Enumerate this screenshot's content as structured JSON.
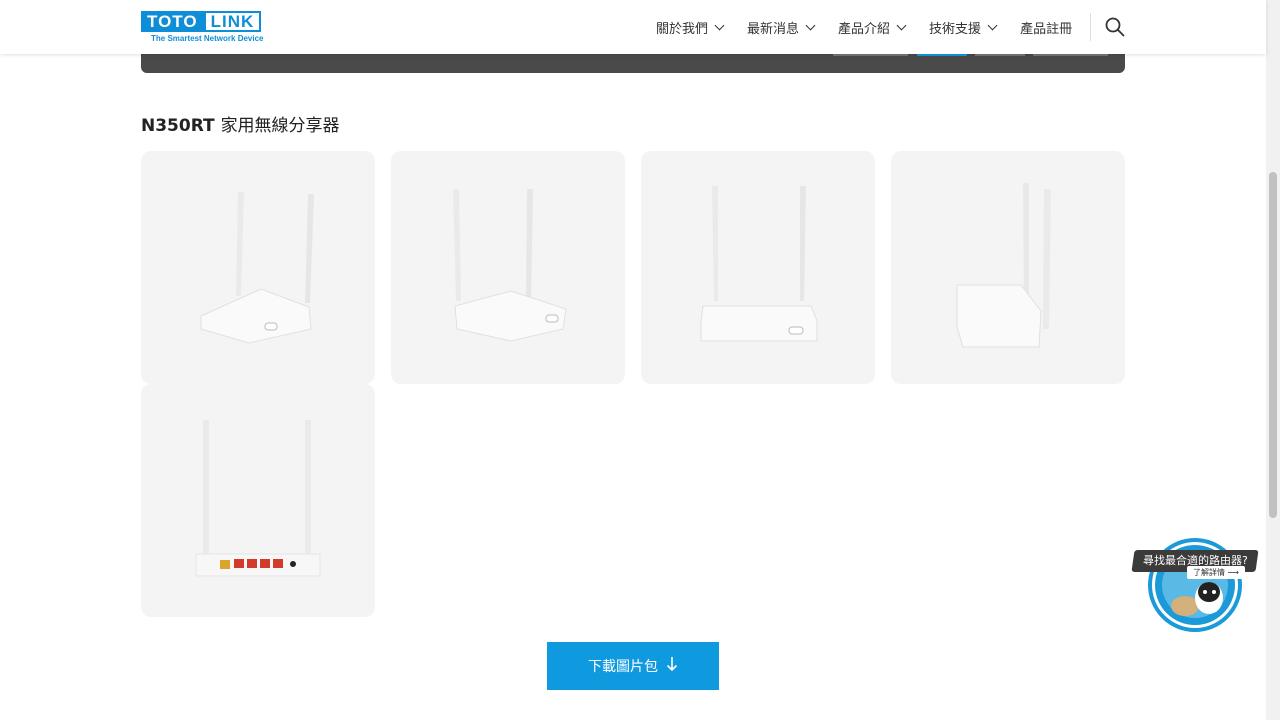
{
  "header": {
    "logo": {
      "brand_left": "TOTO",
      "brand_right": "LINK",
      "tagline": "The Smartest Network Device"
    },
    "nav": [
      {
        "label": "關於我們",
        "has_dropdown": true
      },
      {
        "label": "最新消息",
        "has_dropdown": true
      },
      {
        "label": "產品介紹",
        "has_dropdown": true
      },
      {
        "label": "技術支援",
        "has_dropdown": true
      },
      {
        "label": "產品註冊",
        "has_dropdown": false
      }
    ],
    "search_icon": "search-icon"
  },
  "section": {
    "title_model": "N350RT",
    "title_desc": "家用無線分享器"
  },
  "gallery": {
    "images": [
      {
        "view": "front-left"
      },
      {
        "view": "front-right"
      },
      {
        "view": "front"
      },
      {
        "view": "side"
      },
      {
        "view": "back"
      }
    ]
  },
  "download": {
    "label": "下載圖片包",
    "icon": "arrow-down-icon"
  },
  "helper": {
    "title": "尋找最合適的路由器?",
    "sub": "了解詳情 ⟶"
  },
  "colors": {
    "accent": "#0f9ae0",
    "brand": "#0f8ed8",
    "banner": "#4a4a4a"
  }
}
